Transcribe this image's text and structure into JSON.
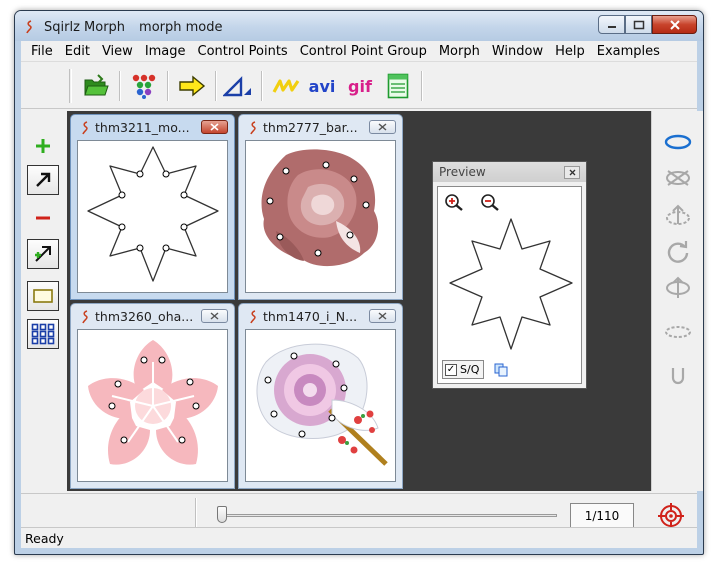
{
  "window": {
    "app_name": "Sqirlz Morph",
    "mode": "morph mode",
    "min_label": "Minimize",
    "max_label": "Maximize",
    "close_label": "Close"
  },
  "menu": [
    "File",
    "Edit",
    "View",
    "Image",
    "Control Points",
    "Control Point Group",
    "Morph",
    "Window",
    "Help",
    "Examples"
  ],
  "toolbar": {
    "avi_label": "avi",
    "gif_label": "gif",
    "icons": [
      "open-folder-icon",
      "color-dots-icon",
      "arrow-right-icon",
      "triangle-mesh-icon",
      "warp-lines-icon",
      "avi-icon",
      "gif-icon",
      "notes-icon"
    ]
  },
  "left_tools": [
    "add-point-icon",
    "select-arrow-icon",
    "remove-point-icon",
    "move-points-icon",
    "rectangle-select-icon",
    "grid-icon"
  ],
  "right_tools": [
    "ellipse-icon",
    "delete-ellipse-icon",
    "rotate-up-icon",
    "rotate-icon",
    "rotate-down-icon",
    "dashed-ellipse-icon",
    "letter-u-icon"
  ],
  "documents": [
    {
      "title": "thm3211_mo...",
      "active": true
    },
    {
      "title": "thm2777_bar...",
      "active": false
    },
    {
      "title": "thm3260_oha...",
      "active": false
    },
    {
      "title": "thm1470_i_N...",
      "active": false
    }
  ],
  "preview": {
    "title": "Preview",
    "sq_label": "S/Q",
    "sq_checked": true
  },
  "timeline": {
    "frame_text": "1/110",
    "current_frame": 1,
    "total_frames": 110
  },
  "status": {
    "text": "Ready"
  },
  "colors": {
    "accent_green": "#2fae1f",
    "accent_red": "#d0221a",
    "accent_blue": "#1b3fa8"
  }
}
